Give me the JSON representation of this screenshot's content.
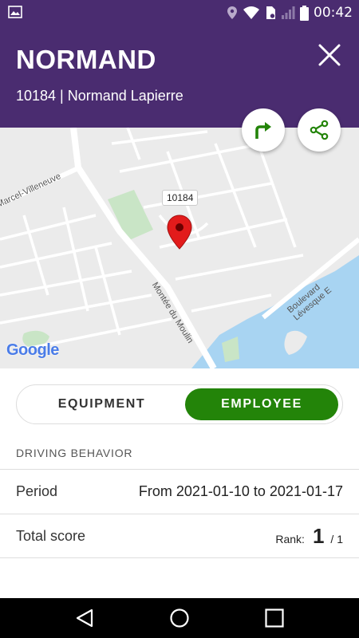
{
  "status_bar": {
    "time": "00:42"
  },
  "header": {
    "title": "NORMAND",
    "subtitle": "10184 | Normand Lapierre"
  },
  "map": {
    "marker_label": "10184",
    "street_labels": [
      "Marcel-Villeneuve",
      "Montée du Moulin",
      "Boulevard Lévesque E"
    ],
    "attribution": "Google"
  },
  "toggle": {
    "equipment_label": "EQUIPMENT",
    "employee_label": "EMPLOYEE",
    "selected": "EMPLOYEE"
  },
  "driving_behavior": {
    "section_title": "DRIVING BEHAVIOR",
    "period_label": "Period",
    "period_value": "From 2021-01-10 to 2021-01-17",
    "score_label": "Total score",
    "rank_label": "Rank:",
    "rank_value": "1",
    "rank_total": "/ 1"
  },
  "colors": {
    "header_bg": "#4a2c70",
    "accent_green": "#238409",
    "marker_red": "#e21b1b",
    "water": "#a8d4f2"
  }
}
